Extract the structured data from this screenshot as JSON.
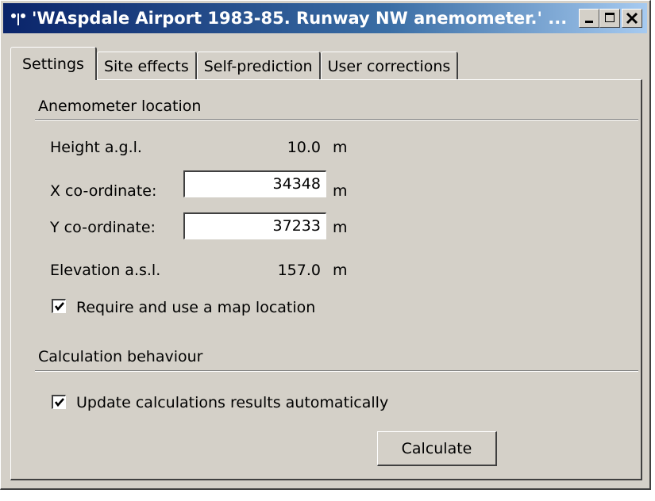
{
  "window": {
    "title": "'WAspdale Airport 1983-85. Runway NW anemometer.' ...",
    "icon": "anemometer-icon",
    "caption_buttons": [
      "minimize-icon",
      "maximize-icon",
      "close-icon"
    ]
  },
  "tabs": [
    {
      "label": "Settings",
      "active": true
    },
    {
      "label": "Site effects",
      "active": false
    },
    {
      "label": "Self-prediction",
      "active": false
    },
    {
      "label": "User corrections",
      "active": false
    }
  ],
  "anemometer": {
    "section_title": "Anemometer location",
    "height_label": "Height a.g.l.",
    "height_value": "10.0",
    "height_unit": "m",
    "x_label": "X co-ordinate:",
    "x_value": "34348",
    "x_unit": "m",
    "y_label": "Y co-ordinate:",
    "y_value": "37233",
    "y_unit": "m",
    "elevation_label": "Elevation a.s.l.",
    "elevation_value": "157.0",
    "elevation_unit": "m",
    "map_checkbox_label": "Require and use a map location",
    "map_checkbox_checked": true
  },
  "calculation": {
    "section_title": "Calculation behaviour",
    "auto_checkbox_label": "Update calculations results automatically",
    "auto_checkbox_checked": true,
    "calculate_button": "Calculate"
  },
  "colors": {
    "titlebar_start": "#0a246a",
    "titlebar_end": "#a6caf0",
    "face": "#d4d0c8"
  }
}
